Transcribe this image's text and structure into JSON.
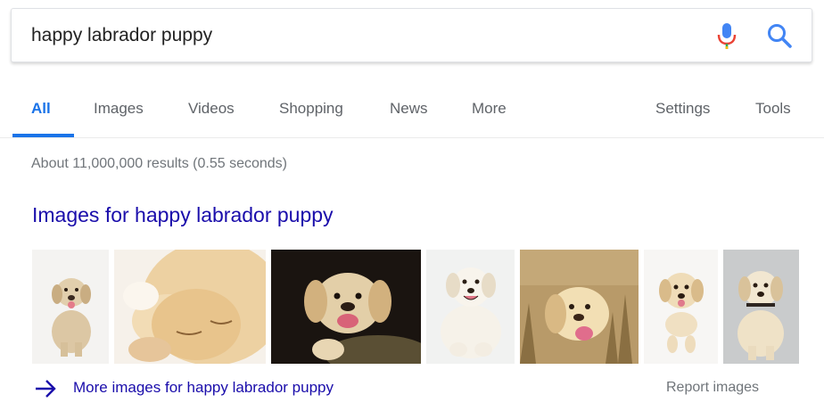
{
  "search": {
    "query": "happy labrador puppy"
  },
  "tabs": [
    {
      "label": "All"
    },
    {
      "label": "Images"
    },
    {
      "label": "Videos"
    },
    {
      "label": "Shopping"
    },
    {
      "label": "News"
    },
    {
      "label": "More"
    },
    {
      "label": "Settings"
    },
    {
      "label": "Tools"
    }
  ],
  "results": {
    "stats": "About 11,000,000 results (0.55 seconds)"
  },
  "images": {
    "heading": "Images for happy labrador puppy",
    "more_label": "More images for happy labrador puppy",
    "report_label": "Report images"
  },
  "colors": {
    "accent": "#1a73e8",
    "link": "#1a0dab",
    "muted": "#70757a"
  },
  "icons": [
    "microphone-icon",
    "search-icon",
    "arrow-right-icon"
  ]
}
